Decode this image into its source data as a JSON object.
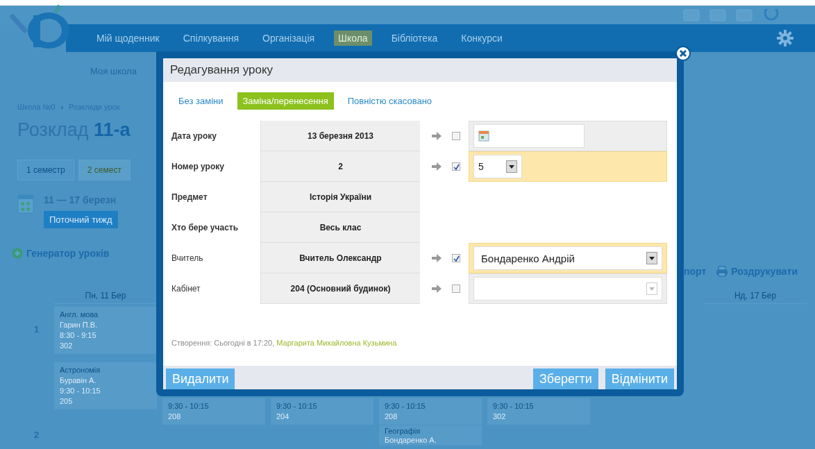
{
  "header": {
    "nav": [
      {
        "label": "Мій щоденник",
        "selected": false
      },
      {
        "label": "Спілкування",
        "selected": false
      },
      {
        "label": "Організація",
        "selected": false
      },
      {
        "label": "Школа",
        "selected": true
      },
      {
        "label": "Бібліотека",
        "selected": false
      },
      {
        "label": "Конкурси",
        "selected": false
      }
    ],
    "subnav": "Моя школа"
  },
  "breadcrumb": {
    "items": [
      "Школа №0",
      "Розклади урок"
    ],
    "separator": "›"
  },
  "page_title": "Розклад **11-а**",
  "semester_tabs": [
    {
      "label": "1 семестр",
      "selected": false
    },
    {
      "label": "2 семест",
      "selected": true
    }
  ],
  "week": {
    "range": "11 — 17 березн",
    "current_button": "Поточний тижд"
  },
  "toolbar": {
    "generator": "Генератор уроків",
    "export": "порт",
    "print": "Роздрукувати"
  },
  "timetable": {
    "columns": [
      "Пн, 11 Бер",
      "Нд, 17 Бер"
    ],
    "rows": [
      {
        "number": "1",
        "cells": [
          {
            "lines": [
              "Англ. мова",
              "Гарин П.В.",
              "8:30 - 9:15",
              "302"
            ]
          }
        ]
      },
      {
        "number": "2",
        "cells": [
          {
            "lines": [
              "Астрономія",
              "Буравін А.",
              "9:30 - 10:15",
              "205"
            ]
          },
          {
            "lines": [
              "9:30 - 10:15",
              "208"
            ]
          },
          {
            "lines": [
              "9:30 - 10:15",
              "204"
            ]
          },
          {
            "lines": [
              "9:30 - 10:15",
              "208"
            ],
            "extra": [
              "Географія",
              "Бондаренко А."
            ]
          },
          {
            "lines": [
              "9:30 - 10:15",
              "302"
            ]
          }
        ]
      }
    ]
  },
  "dialog": {
    "title": "Редагування уроку",
    "tabs": [
      {
        "label": "Без заміни",
        "selected": false
      },
      {
        "label": "Заміна/перенесення",
        "selected": true
      },
      {
        "label": "Повністю скасовано",
        "selected": false
      }
    ],
    "fields": [
      {
        "kind": "change",
        "label": "Дата уроку",
        "value": "13 березня 2013",
        "checked": false,
        "input": {
          "kind": "date"
        }
      },
      {
        "kind": "change",
        "label": "Номер уроку",
        "value": "2",
        "checked": true,
        "input": {
          "kind": "short-select",
          "value": "5",
          "disabled": false
        }
      },
      {
        "kind": "info",
        "label": "Предмет",
        "value": "Історія України"
      },
      {
        "kind": "info",
        "label": "Хто бере участь",
        "value": "Весь клас"
      },
      {
        "kind": "change",
        "label": "Вчитель",
        "value": "Вчитель Олександр",
        "checked": true,
        "input": {
          "kind": "select",
          "value": "Бондаренко Андрій",
          "disabled": false
        }
      },
      {
        "kind": "change",
        "label": "Кабінет",
        "value": "204 (Основний будинок)",
        "checked": false,
        "input": {
          "kind": "select",
          "disabled": true
        }
      }
    ],
    "created": {
      "text": "Створення: Сьогодні в 17:20, ",
      "author": "Маргарита Михайловна Кузьмина"
    },
    "buttons": [
      {
        "label": "Видалити",
        "kind": "left"
      },
      {
        "label": "Зберегти",
        "kind": "right"
      },
      {
        "label": "Відмінити",
        "kind": "right"
      }
    ]
  }
}
